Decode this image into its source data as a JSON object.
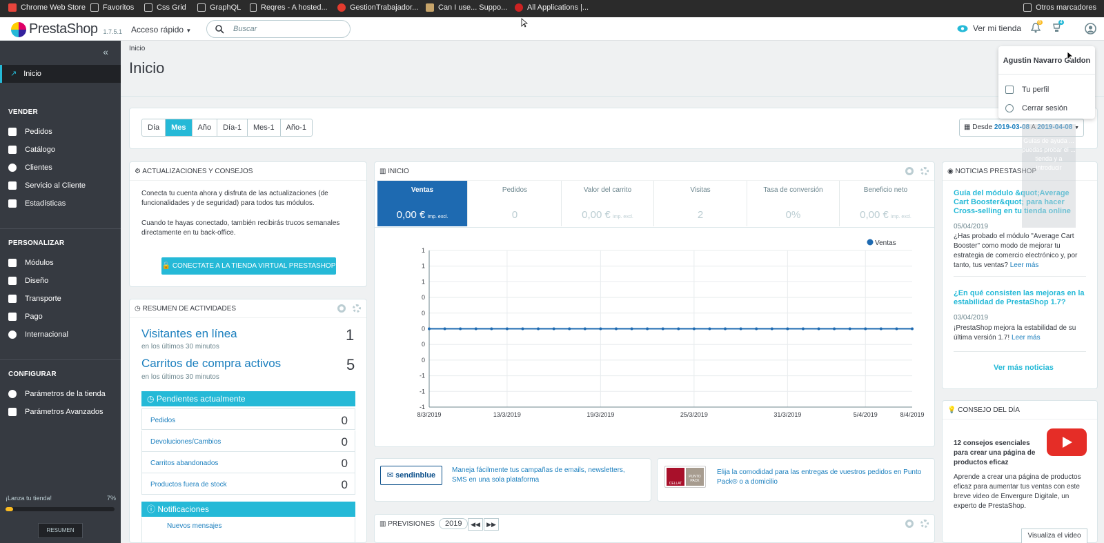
{
  "bookmarks": [
    {
      "label": "Chrome Web Store",
      "icon": "chrome-store-icon",
      "color": "#e8453c"
    },
    {
      "label": "Favoritos",
      "icon": "folder-icon"
    },
    {
      "label": "Css Grid",
      "icon": "folder-icon"
    },
    {
      "label": "GraphQL",
      "icon": "folder-icon"
    },
    {
      "label": "Reqres - A hosted...",
      "icon": "page-icon"
    },
    {
      "label": "GestionTrabajador...",
      "icon": "a-icon",
      "color": "#e33b2e"
    },
    {
      "label": "Can I use... Suppo...",
      "icon": "caniuse-icon",
      "color": "#c7a46a"
    },
    {
      "label": "All Applications |...",
      "icon": "redhat-icon",
      "color": "#cc2222"
    }
  ],
  "bookmarks_other": "Otros marcadores",
  "header": {
    "brand": "PrestaShop",
    "version": "1.7.5.1",
    "quick_access": "Acceso rápido",
    "search_placeholder": "Buscar",
    "view_store": "Ver mi tienda",
    "notif_count": "6",
    "cart_count": "4"
  },
  "user_menu": {
    "name": "Agustin Navarro Galdon",
    "profile": "Tu perfil",
    "logout": "Cerrar sesión"
  },
  "sidebar": {
    "home": "Inicio",
    "sections": [
      {
        "title": "VENDER",
        "items": [
          "Pedidos",
          "Catálogo",
          "Clientes",
          "Servicio al Cliente",
          "Estadísticas"
        ]
      },
      {
        "title": "PERSONALIZAR",
        "items": [
          "Módulos",
          "Diseño",
          "Transporte",
          "Pago",
          "Internacional"
        ]
      },
      {
        "title": "CONFIGURAR",
        "items": [
          "Parámetros de la tienda",
          "Parámetros Avanzados"
        ]
      }
    ],
    "launch_label": "¡Lanza tu tienda!",
    "launch_percent": "7%",
    "launch_progress": 0.07,
    "resumen_button": "RESUMEN"
  },
  "page": {
    "breadcrumb": "Inicio",
    "title": "Inicio"
  },
  "periods": [
    "Día",
    "Mes",
    "Año",
    "Día-1",
    "Mes-1",
    "Año-1"
  ],
  "active_period": "Mes",
  "date_range": {
    "prefix": "Desde",
    "from": "2019-03-08",
    "joiner": "A",
    "to": "2019-04-08"
  },
  "updates_panel": {
    "title": "ACTUALIZACIONES Y CONSEJOS",
    "text1": "Conecta tu cuenta ahora y disfruta de las actualizaciones (de funcionalidades y de seguridad) para todos tus módulos.",
    "text2": "Cuando te hayas conectado, también recibirás trucos semanales directamente en tu back-office.",
    "button": "CONECTATE A LA TIENDA VIRTUAL PRESTASHOP"
  },
  "activity_panel": {
    "title": "RESUMEN DE ACTIVIDADES",
    "visitors_label": "Visitantes en línea",
    "visitors_sub": "en los últimos 30 minutos",
    "visitors_value": "1",
    "carts_label": "Carritos de compra activos",
    "carts_sub": "en los últimos 30 minutos",
    "carts_value": "5",
    "pending_title": "Pendientes actualmente",
    "pending": [
      {
        "label": "Pedidos",
        "value": "0"
      },
      {
        "label": "Devoluciones/Cambios",
        "value": "0"
      },
      {
        "label": "Carritos abandonados",
        "value": "0"
      },
      {
        "label": "Productos fuera de stock",
        "value": "0"
      }
    ],
    "notifications_title": "Notificaciones",
    "new_messages": "Nuevos mensajes"
  },
  "dashboard_panel": {
    "title": "INICIO",
    "kpis": [
      {
        "label": "Ventas",
        "value": "0,00 €",
        "unit": "Imp. excl."
      },
      {
        "label": "Pedidos",
        "value": "0",
        "unit": ""
      },
      {
        "label": "Valor del carrito",
        "value": "0,00 €",
        "unit": "Imp. excl."
      },
      {
        "label": "Visitas",
        "value": "2",
        "unit": ""
      },
      {
        "label": "Tasa de conversión",
        "value": "0%",
        "unit": ""
      },
      {
        "label": "Beneficio neto",
        "value": "0,00 €",
        "unit": "Imp. excl."
      }
    ]
  },
  "chart_data": {
    "type": "line",
    "title": "",
    "xlabel": "",
    "ylabel": "",
    "x_tick_labels": [
      "8/3/2019",
      "13/3/2019",
      "19/3/2019",
      "25/3/2019",
      "31/3/2019",
      "5/4/2019",
      "8/4/2019"
    ],
    "y_tick_labels": [
      "1",
      "1",
      "1",
      "0",
      "0",
      "0",
      "0",
      "0",
      "-1",
      "-1",
      "-1"
    ],
    "ylim": [
      -1,
      1
    ],
    "grid": true,
    "legend_position": "top-right",
    "series": [
      {
        "name": "Ventas",
        "color": "#1e6ab1",
        "values": [
          0,
          0,
          0,
          0,
          0,
          0,
          0,
          0,
          0,
          0,
          0,
          0,
          0,
          0,
          0,
          0,
          0,
          0,
          0,
          0,
          0,
          0,
          0,
          0,
          0,
          0,
          0,
          0,
          0,
          0,
          0,
          0
        ]
      }
    ]
  },
  "promos": [
    {
      "logo": "sendinblue",
      "text": "Maneja fácilmente tus campañas de emails, newsletters, SMS en una sola plataforma"
    },
    {
      "logo_left": "CELLAT",
      "logo_right": "PUNTO PACK",
      "text": "Elija la comodidad para las entregas de vuestros pedidos en Punto Pack® o a domicilio"
    }
  ],
  "forecast_panel": {
    "title": "PREVISIONES",
    "year": "2019"
  },
  "news_panel": {
    "title": "NOTICIAS PRESTASHOP",
    "items": [
      {
        "title": "Guía del módulo &quot;Average Cart Booster&quot; para hacer Cross-selling en tu tienda online",
        "date": "05/04/2019",
        "body": "¿Has probado el módulo \"Average Cart Booster\" como modo de mejorar tu estrategia de comercio electrónico y, por tanto, tus ventas?",
        "more": "Leer más"
      },
      {
        "title": "¿En qué consisten las mejoras en la estabilidad de PrestaShop 1.7?",
        "date": "03/04/2019",
        "body": "¡PrestaShop mejora la estabilidad de su última versión 1.7!",
        "more": "Leer más"
      }
    ],
    "more_news": "Ver más noticias"
  },
  "tip_panel": {
    "title": "CONSEJO DEL DÍA",
    "heading": "12 consejos esenciales para crear una página de productos eficaz",
    "body": "Aprende a crear una página de productos eficaz para aumentar tus ventas con este breve video de Envergure Digitale, un experto de PrestaShop.",
    "button": "Visualiza el video"
  },
  "overlay_text": "Guías de ayuda ... puedas probar el ... tienda y a introducir"
}
